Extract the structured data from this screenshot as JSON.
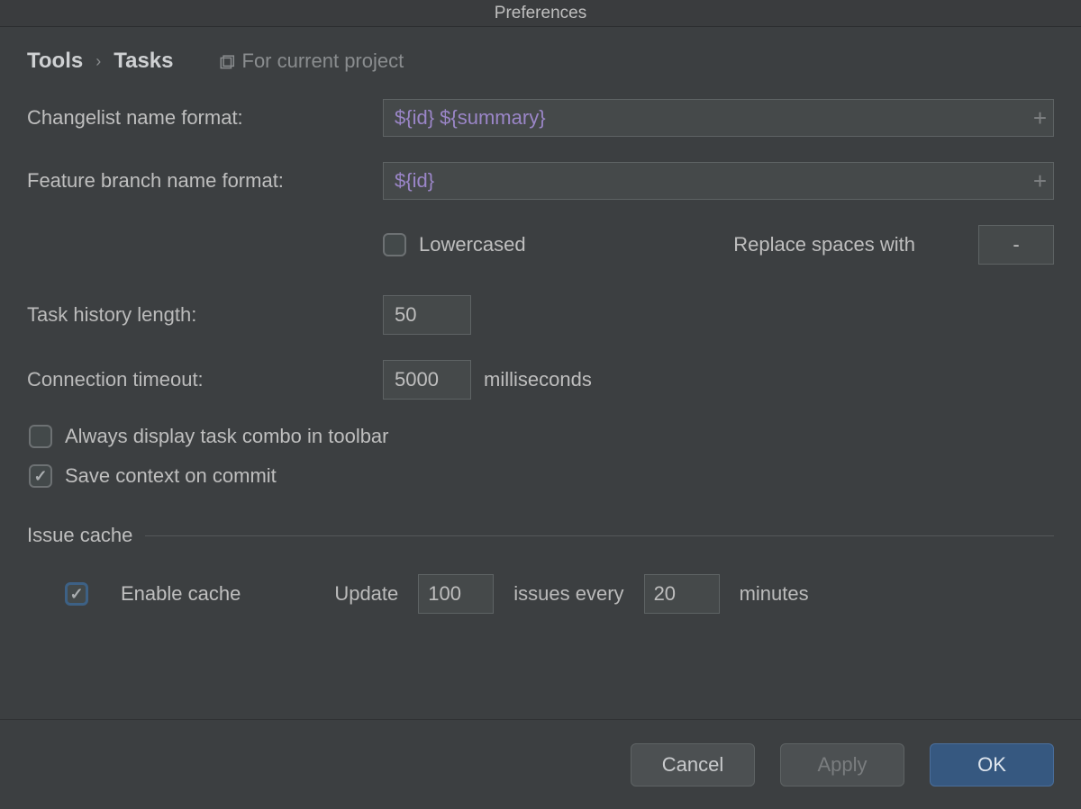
{
  "window": {
    "title": "Preferences"
  },
  "breadcrumb": {
    "parent": "Tools",
    "current": "Tasks",
    "scope_label": "For current project"
  },
  "fields": {
    "changelist_format": {
      "label": "Changelist name format:",
      "value": "${id} ${summary}"
    },
    "branch_format": {
      "label": "Feature branch name format:",
      "value": "${id}"
    },
    "lowercased": {
      "label": "Lowercased",
      "checked": false
    },
    "replace_spaces": {
      "label": "Replace spaces with",
      "value": "-"
    },
    "history_length": {
      "label": "Task history length:",
      "value": "50"
    },
    "connection_timeout": {
      "label": "Connection timeout:",
      "value": "5000",
      "unit": "milliseconds"
    },
    "always_display": {
      "label": "Always display task combo in toolbar",
      "checked": false
    },
    "save_context": {
      "label": "Save context on commit",
      "checked": true
    }
  },
  "issue_cache": {
    "title": "Issue cache",
    "enable": {
      "label": "Enable cache",
      "checked": true
    },
    "update_prefix": "Update",
    "issues": "100",
    "every_label": "issues every",
    "interval": "20",
    "unit": "minutes"
  },
  "footer": {
    "cancel": "Cancel",
    "apply": "Apply",
    "ok": "OK"
  }
}
